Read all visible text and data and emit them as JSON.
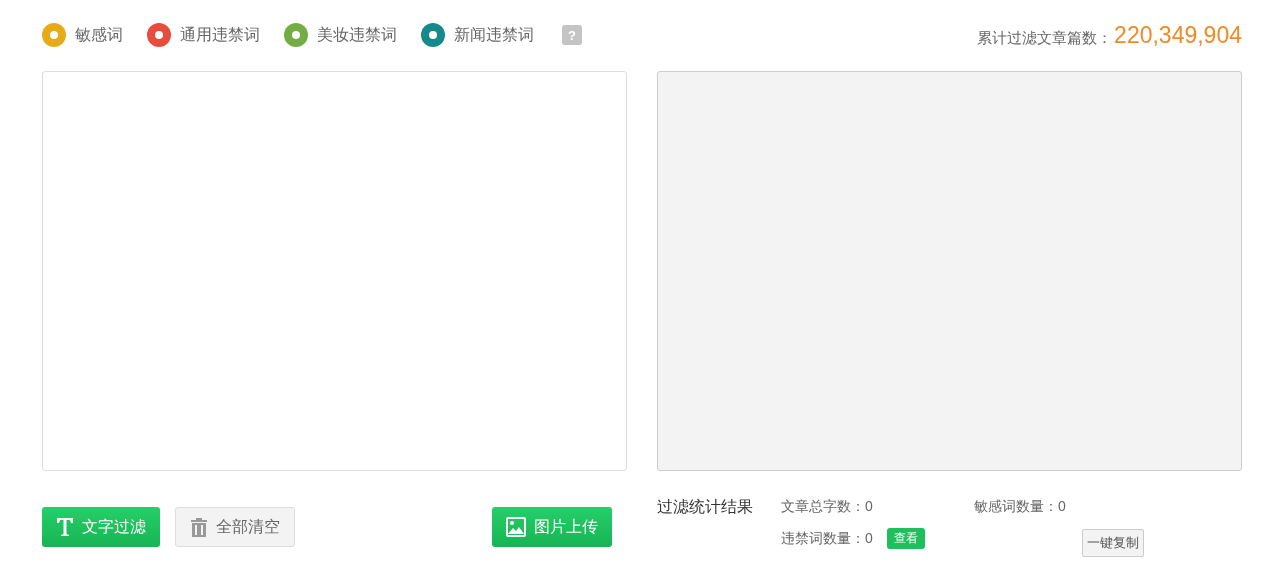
{
  "legend": [
    {
      "label": "敏感词",
      "color": "#e6ab17"
    },
    {
      "label": "通用违禁词",
      "color": "#e84c3d"
    },
    {
      "label": "美妆违禁词",
      "color": "#72ae44"
    },
    {
      "label": "新闻违禁词",
      "color": "#168a8a"
    }
  ],
  "help": "?",
  "counter": {
    "label": "累计过滤文章篇数：",
    "value": "220,349,904"
  },
  "actions": [
    {
      "label": "文字过滤",
      "kind": "text",
      "primary": true
    },
    {
      "label": "全部清空",
      "kind": "clear",
      "primary": false
    },
    {
      "label": "图片上传",
      "kind": "image",
      "primary": true
    }
  ],
  "stats": {
    "title": "过滤统计结果",
    "items": [
      {
        "label": "文章总字数：",
        "value": "0"
      },
      {
        "label": "敏感词数量：",
        "value": "0"
      },
      {
        "label": "违禁词数量：",
        "value": "0"
      }
    ],
    "view_button": "查看",
    "copy_button": "一键复制"
  }
}
